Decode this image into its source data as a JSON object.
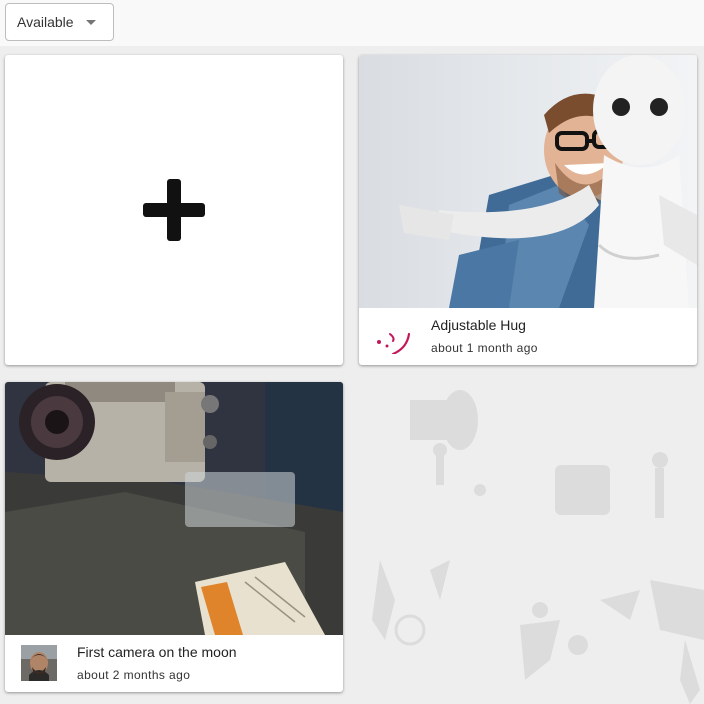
{
  "filter": {
    "selected": "Available",
    "icon": "chevron-down-icon"
  },
  "add_card": {
    "icon": "plus-icon"
  },
  "cards": [
    {
      "title": "Adjustable Hug",
      "time": "about 1 month ago",
      "avatar_icon": "winking-face-icon",
      "avatar_color": "#c2185b"
    },
    {
      "title": "First camera on the moon",
      "time": "about 2 months ago",
      "avatar_icon": "user-photo"
    }
  ],
  "colors": {
    "background": "#efefef",
    "card": "#ffffff",
    "accent": "#c2185b"
  }
}
